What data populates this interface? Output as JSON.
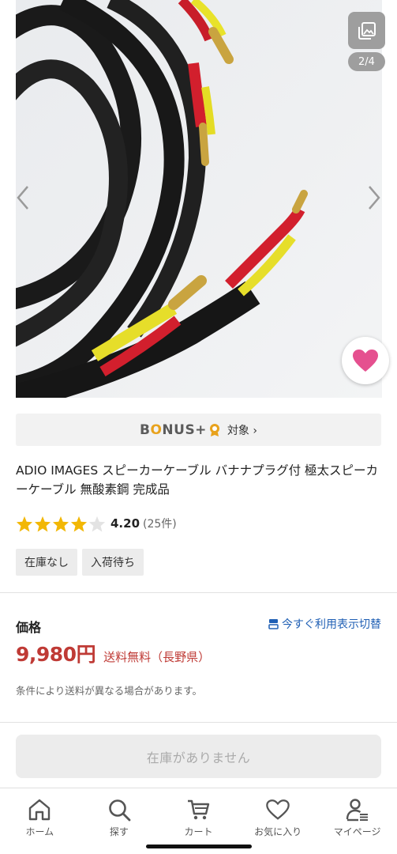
{
  "gallery": {
    "page_indicator": "2/4",
    "image_alt": "Speaker cable with banana plugs"
  },
  "bonus": {
    "logo_prefix": "B",
    "logo_o": "O",
    "logo_suffix": "NUS+",
    "target_label": "対象 ›"
  },
  "product": {
    "title": "ADIO IMAGES スピーカーケーブル バナナプラグ付 極太スピーカーケーブル 無酸素鋼 完成品",
    "rating": "4.20",
    "review_count": "(25件)",
    "stars_filled": 4,
    "stars_total": 5,
    "tags": [
      "在庫なし",
      "入荷待ち"
    ]
  },
  "price": {
    "label": "価格",
    "tax_toggle": "今すぐ利用表示切替",
    "amount": "9,980円",
    "shipping": "送料無料（長野県）",
    "note": "条件により送料が異なる場合があります。"
  },
  "cta": {
    "label": "在庫がありません"
  },
  "bottom_nav": {
    "items": [
      {
        "label": "ホーム",
        "icon": "home-icon"
      },
      {
        "label": "探す",
        "icon": "search-icon"
      },
      {
        "label": "カート",
        "icon": "cart-icon"
      },
      {
        "label": "お気に入り",
        "icon": "heart-icon"
      },
      {
        "label": "マイページ",
        "icon": "user-icon"
      }
    ]
  },
  "colors": {
    "price_red": "#bf3a35",
    "favorite_pink": "#e5508f",
    "star_gold": "#f2b705",
    "link_blue": "#1f5fb4"
  }
}
